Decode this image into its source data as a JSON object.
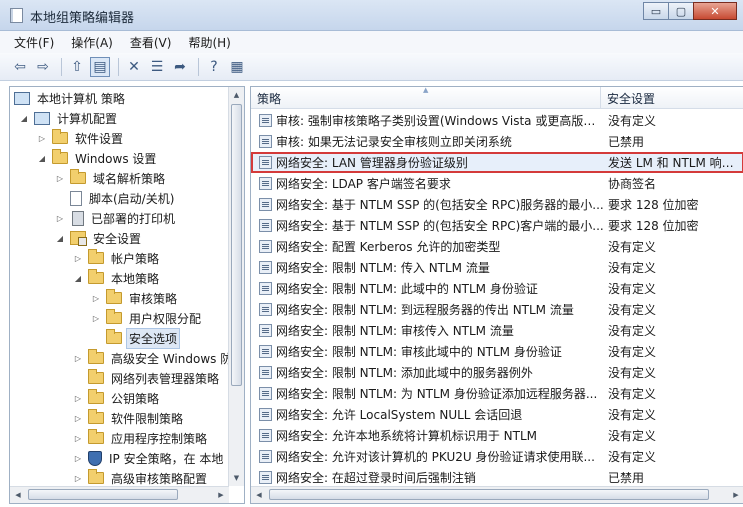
{
  "window": {
    "title": "本地组策略编辑器",
    "minimize_glyph": "▭",
    "maximize_glyph": "▢",
    "close_glyph": "✕"
  },
  "menu": {
    "items": [
      "文件(F)",
      "操作(A)",
      "查看(V)",
      "帮助(H)"
    ]
  },
  "toolbar": {
    "back_glyph": "⇦",
    "forward_glyph": "⇨",
    "up_glyph": "⇧",
    "show_hide_glyph": "▤",
    "delete_glyph": "✕",
    "properties_glyph": "☰",
    "export_glyph": "➦",
    "help_glyph": "?",
    "view_glyph": "▦"
  },
  "tree": {
    "items": [
      {
        "label": "本地计算机 策略",
        "toggle": "",
        "icon": "pc-icon"
      },
      {
        "label": "计算机配置",
        "toggle": "◢",
        "icon": "pc-icon"
      },
      {
        "label": "软件设置",
        "toggle": "▷",
        "icon": "folder-icon"
      },
      {
        "label": "Windows 设置",
        "toggle": "◢",
        "icon": "folder-icon"
      },
      {
        "label": "域名解析策略",
        "toggle": "▷",
        "icon": "folder-icon"
      },
      {
        "label": "脚本(启动/关机)",
        "toggle": "",
        "icon": "doc-icon"
      },
      {
        "label": "已部署的打印机",
        "toggle": "▷",
        "icon": "server-icon"
      },
      {
        "label": "安全设置",
        "toggle": "◢",
        "icon": "lock-icon"
      },
      {
        "label": "帐户策略",
        "toggle": "▷",
        "icon": "folder-icon"
      },
      {
        "label": "本地策略",
        "toggle": "◢",
        "icon": "folder-icon"
      },
      {
        "label": "审核策略",
        "toggle": "▷",
        "icon": "folder-icon"
      },
      {
        "label": "用户权限分配",
        "toggle": "▷",
        "icon": "folder-icon"
      },
      {
        "label": "安全选项",
        "toggle": "",
        "icon": "folder-icon"
      },
      {
        "label": "高级安全 Windows 防",
        "toggle": "▷",
        "icon": "folder-icon"
      },
      {
        "label": "网络列表管理器策略",
        "toggle": "",
        "icon": "folder-icon"
      },
      {
        "label": "公钥策略",
        "toggle": "▷",
        "icon": "folder-icon"
      },
      {
        "label": "软件限制策略",
        "toggle": "▷",
        "icon": "folder-icon"
      },
      {
        "label": "应用程序控制策略",
        "toggle": "▷",
        "icon": "folder-icon"
      },
      {
        "label": "IP 安全策略，在 本地",
        "toggle": "▷",
        "icon": "shield-icon"
      },
      {
        "label": "高级审核策略配置",
        "toggle": "▷",
        "icon": "folder-icon"
      }
    ],
    "selected_label": "安全选项"
  },
  "list": {
    "columns": {
      "policy": "策略",
      "setting": "安全设置"
    },
    "rows": [
      {
        "policy": "审核: 强制审核策略子类别设置(Windows Vista 或更高版本...",
        "setting": "没有定义"
      },
      {
        "policy": "审核: 如果无法记录安全审核则立即关闭系统",
        "setting": "已禁用"
      },
      {
        "policy": "网络安全: LAN 管理器身份验证级别",
        "setting": "发送 LM 和 NTLM 响应..."
      },
      {
        "policy": "网络安全: LDAP 客户端签名要求",
        "setting": "协商签名"
      },
      {
        "policy": "网络安全: 基于 NTLM SSP 的(包括安全 RPC)服务器的最小...",
        "setting": "要求 128 位加密"
      },
      {
        "policy": "网络安全: 基于 NTLM SSP 的(包括安全 RPC)客户端的最小...",
        "setting": "要求 128 位加密"
      },
      {
        "policy": "网络安全: 配置 Kerberos 允许的加密类型",
        "setting": "没有定义"
      },
      {
        "policy": "网络安全: 限制 NTLM: 传入 NTLM 流量",
        "setting": "没有定义"
      },
      {
        "policy": "网络安全: 限制 NTLM: 此域中的 NTLM 身份验证",
        "setting": "没有定义"
      },
      {
        "policy": "网络安全: 限制 NTLM: 到远程服务器的传出 NTLM 流量",
        "setting": "没有定义"
      },
      {
        "policy": "网络安全: 限制 NTLM: 审核传入 NTLM 流量",
        "setting": "没有定义"
      },
      {
        "policy": "网络安全: 限制 NTLM: 审核此域中的 NTLM 身份验证",
        "setting": "没有定义"
      },
      {
        "policy": "网络安全: 限制 NTLM: 添加此域中的服务器例外",
        "setting": "没有定义"
      },
      {
        "policy": "网络安全: 限制 NTLM: 为 NTLM 身份验证添加远程服务器...",
        "setting": "没有定义"
      },
      {
        "policy": "网络安全: 允许 LocalSystem NULL 会话回退",
        "setting": "没有定义"
      },
      {
        "policy": "网络安全: 允许本地系统将计算机标识用于 NTLM",
        "setting": "没有定义"
      },
      {
        "policy": "网络安全: 允许对该计算机的 PKU2U 身份验证请求使用联...",
        "setting": "没有定义"
      },
      {
        "policy": "网络安全: 在超过登录时间后强制注销",
        "setting": "已禁用"
      }
    ],
    "highlighted_policy": "网络安全: LAN 管理器身份验证级别"
  },
  "scroll_arrows": {
    "up": "▲",
    "down": "▼",
    "left": "◀",
    "right": "▶"
  },
  "colors": {
    "highlight_border": "#d43a3a",
    "selection_bg": "#dde7f5",
    "title_bar": "#c6d6ec"
  }
}
